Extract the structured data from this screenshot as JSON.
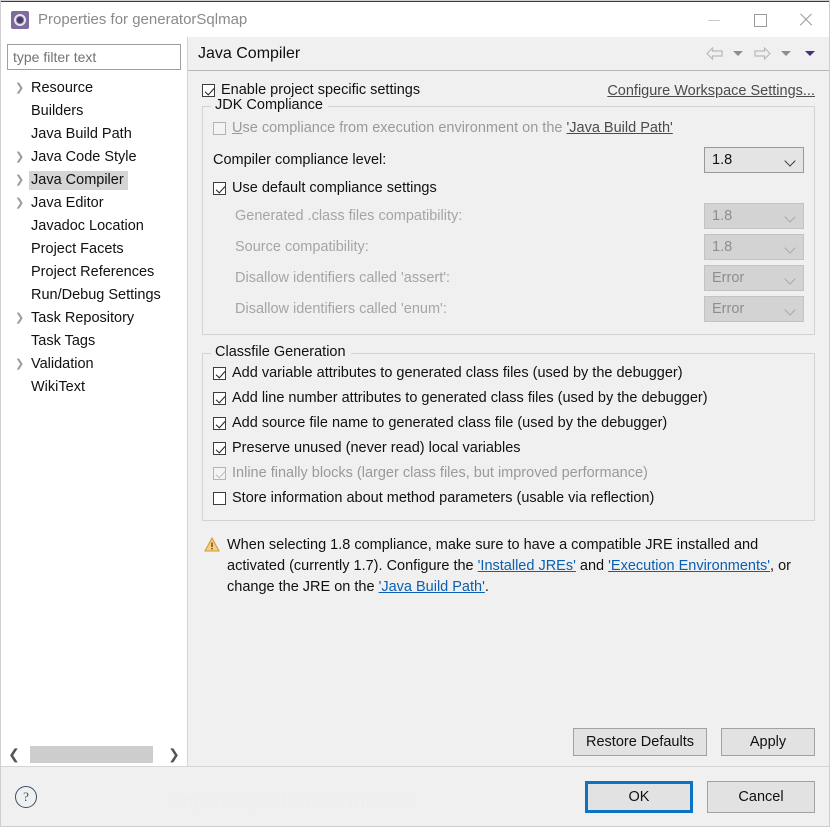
{
  "window": {
    "title": "Properties for generatorSqlmap",
    "icon": "gear-icon",
    "minimize": "minimize",
    "maximize": "maximize",
    "close": "close"
  },
  "sidebar": {
    "filter": {
      "placeholder": "type filter text",
      "value": ""
    },
    "items": [
      {
        "label": "Resource",
        "expandable": true,
        "selected": false
      },
      {
        "label": "Builders",
        "expandable": false,
        "selected": false
      },
      {
        "label": "Java Build Path",
        "expandable": false,
        "selected": false
      },
      {
        "label": "Java Code Style",
        "expandable": true,
        "selected": false
      },
      {
        "label": "Java Compiler",
        "expandable": true,
        "selected": true
      },
      {
        "label": "Java Editor",
        "expandable": true,
        "selected": false
      },
      {
        "label": "Javadoc Location",
        "expandable": false,
        "selected": false
      },
      {
        "label": "Project Facets",
        "expandable": false,
        "selected": false
      },
      {
        "label": "Project References",
        "expandable": false,
        "selected": false
      },
      {
        "label": "Run/Debug Settings",
        "expandable": false,
        "selected": false
      },
      {
        "label": "Task Repository",
        "expandable": true,
        "selected": false
      },
      {
        "label": "Task Tags",
        "expandable": false,
        "selected": false
      },
      {
        "label": "Validation",
        "expandable": true,
        "selected": false
      },
      {
        "label": "WikiText",
        "expandable": false,
        "selected": false
      }
    ],
    "scroll_left_icon": "chevron-left-icon",
    "scroll_right_icon": "chevron-right-icon"
  },
  "page": {
    "title": "Java Compiler",
    "nav": {
      "back_icon": "arrow-left-icon",
      "back_menu_icon": "chevron-down-icon",
      "forward_icon": "arrow-right-icon",
      "forward_menu_icon": "chevron-down-icon",
      "view_menu_icon": "chevron-down-icon"
    },
    "enable_project_specific": {
      "label": "Enable project specific settings",
      "checked": true
    },
    "configure_workspace_link": "Configure Workspace Settings...",
    "jdk_compliance": {
      "title": "JDK Compliance",
      "use_execution_env": {
        "label_prefix": "",
        "mnemonic": "U",
        "label": "se compliance from execution environment on the ",
        "link": "'Java Build Path'",
        "checked": false,
        "enabled": false
      },
      "compliance_level": {
        "label": "Compiler compliance level:",
        "value": "1.8",
        "enabled": true
      },
      "use_default_compliance": {
        "label": "Use default compliance settings",
        "checked": true,
        "enabled": true
      },
      "rows": [
        {
          "label": "Generated .class files compatibility:",
          "value": "1.8",
          "enabled": false
        },
        {
          "label": "Source compatibility:",
          "value": "1.8",
          "enabled": false
        },
        {
          "label": "Disallow identifiers called 'assert':",
          "value": "Error",
          "enabled": false
        },
        {
          "label": "Disallow identifiers called 'enum':",
          "value": "Error",
          "enabled": false
        }
      ]
    },
    "classfile_generation": {
      "title": "Classfile Generation",
      "options": [
        {
          "label": "Add variable attributes to generated class files (used by the debugger)",
          "checked": true,
          "enabled": true
        },
        {
          "label": "Add line number attributes to generated class files (used by the debugger)",
          "checked": true,
          "enabled": true
        },
        {
          "label": "Add source file name to generated class file (used by the debugger)",
          "checked": true,
          "enabled": true
        },
        {
          "label": "Preserve unused (never read) local variables",
          "checked": true,
          "enabled": true
        },
        {
          "label": "Inline finally blocks (larger class files, but improved performance)",
          "checked": true,
          "enabled": false
        },
        {
          "label": "Store information about method parameters (usable via reflection)",
          "checked": false,
          "enabled": true
        }
      ]
    },
    "warning": {
      "icon": "warning-icon",
      "part1": "When selecting 1.8 compliance, make sure to have a compatible JRE installed and activated (currently 1.7). Configure the ",
      "link1": "'Installed JREs'",
      "part2": " and ",
      "link2": "'Execution Environments'",
      "part3": ", or change the JRE on the ",
      "link3": "'Java Build Path'",
      "part4": "."
    },
    "actions": {
      "restore_defaults": "Restore Defaults",
      "apply": "Apply"
    }
  },
  "footer": {
    "help_icon": "question-mark-icon",
    "help_glyph": "?",
    "ok": "OK",
    "cancel": "Cancel"
  },
  "watermark": "http://blog.csdn.net/maijia0754",
  "colors": {
    "accent_blue": "#0b72c4",
    "link_blue": "#0b5fb0",
    "warning_amber": "#e8a33d",
    "selection_grey": "#d5d5d5",
    "dialog_bg": "#f0f0f0"
  }
}
